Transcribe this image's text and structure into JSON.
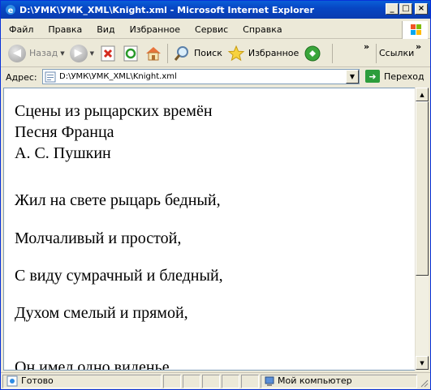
{
  "window": {
    "title": "D:\\УМК\\УМК_XML\\Knight.xml - Microsoft Internet Explorer",
    "minimize": "_",
    "maximize": "□",
    "close": "×"
  },
  "menu": {
    "items": [
      "Файл",
      "Правка",
      "Вид",
      "Избранное",
      "Сервис",
      "Справка"
    ]
  },
  "toolbar": {
    "back_label": "Назад",
    "search_label": "Поиск",
    "favorites_label": "Избранное",
    "chevron": "»",
    "links_label": "Ссылки"
  },
  "address": {
    "label": "Адрес:",
    "value": "D:\\УМК\\УМК_XML\\Knight.xml",
    "go_label": "Переход"
  },
  "document": {
    "heading_lines": [
      "Сцены из рыцарских времён",
      "Песня Франца",
      "А. С. Пушкин"
    ],
    "verses": [
      "Жил на свете рыцарь бедный,",
      "Молчаливый и простой,",
      "С виду сумрачный и бледный,",
      "Духом смелый и прямой,",
      "Он имел одно виденье,"
    ]
  },
  "status": {
    "text": "Готово",
    "zone": "Мой компьютер"
  }
}
